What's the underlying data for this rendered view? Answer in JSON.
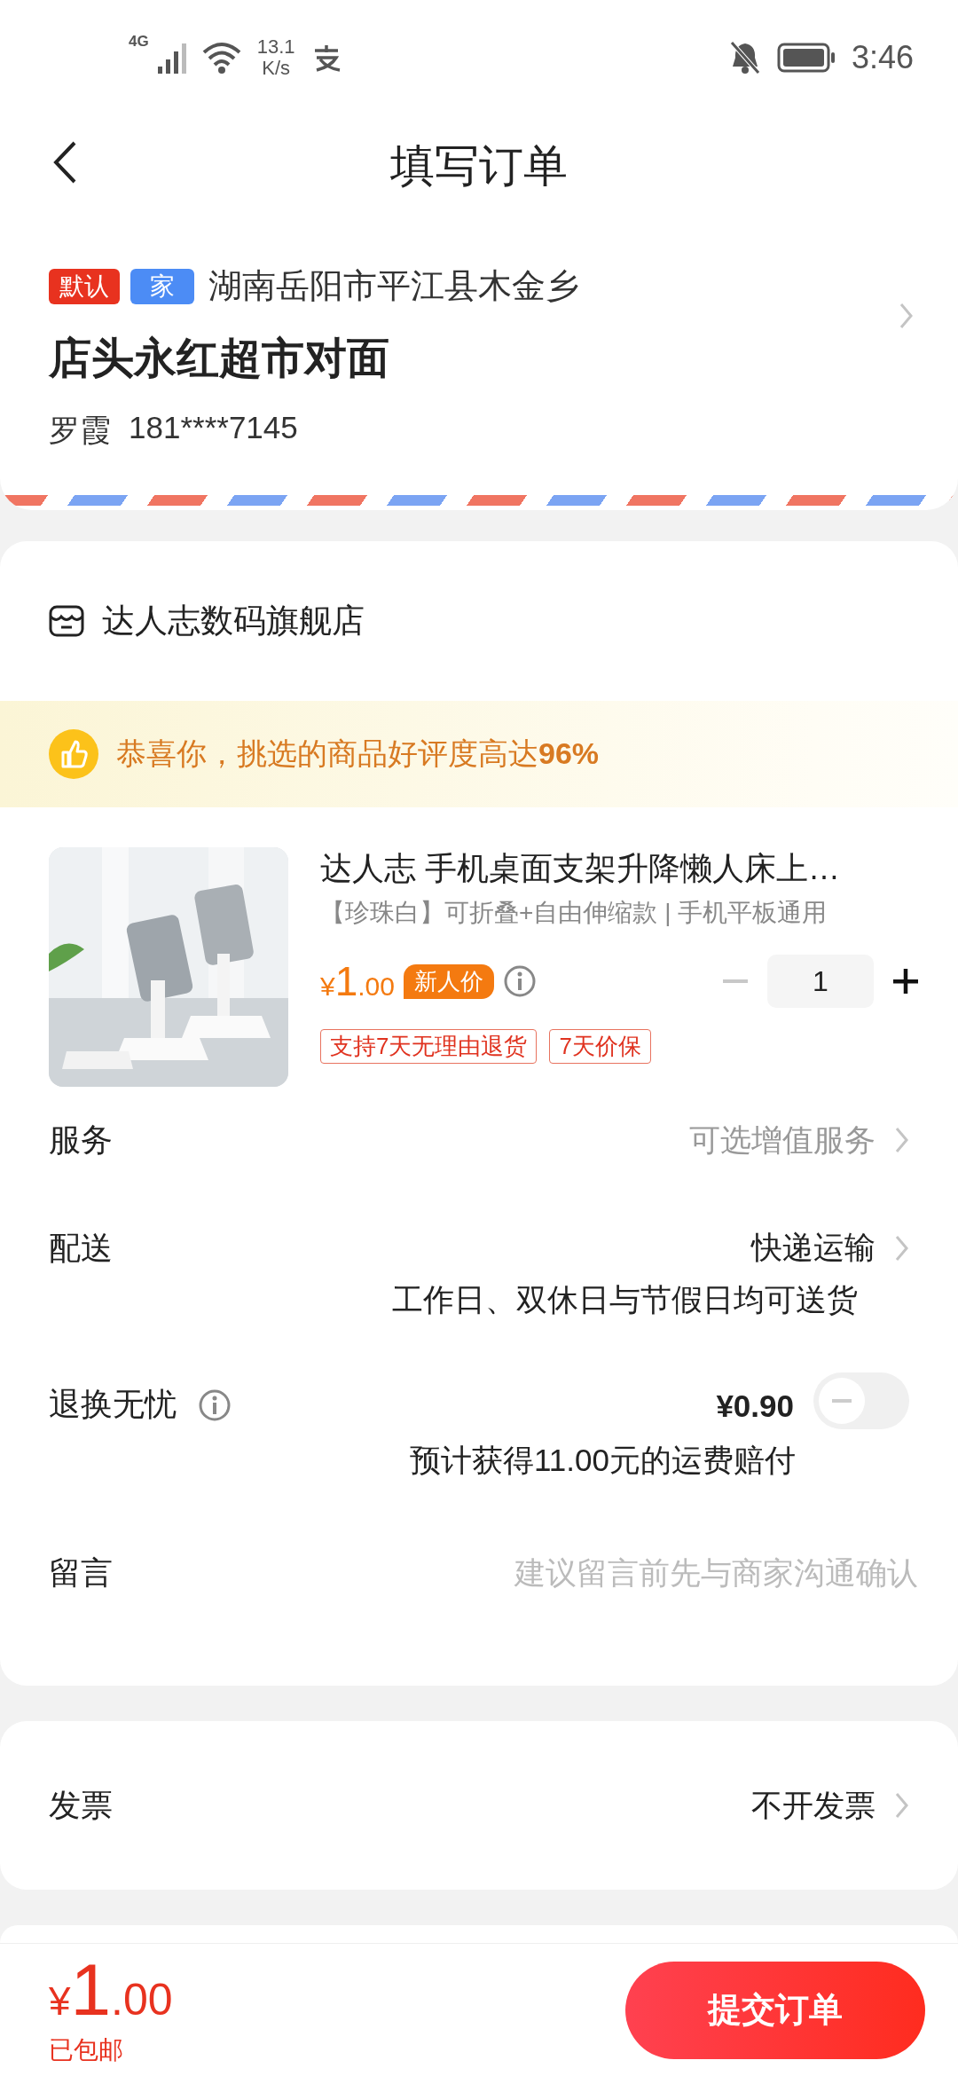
{
  "status_bar": {
    "network": "4G",
    "speed_value": "13.1",
    "speed_unit": "K/s",
    "time": "3:46"
  },
  "header": {
    "title": "填写订单"
  },
  "address": {
    "tags": [
      {
        "label": "默认",
        "color": "#e8321f"
      },
      {
        "label": "家",
        "color": "#4c8cf5"
      }
    ],
    "region": "湖南岳阳市平江县木金乡",
    "street": "店头永红超市对面",
    "recipient": "罗霞",
    "phone": "181****7145"
  },
  "store": {
    "name": "达人志数码旗舰店"
  },
  "banner": {
    "text": "恭喜你，挑选的商品好评度高达**96%**"
  },
  "product": {
    "title": "达人志 手机桌面支架升降懒人床上…",
    "spec": "【珍珠白】可折叠+自由伸缩款 | 手机平板通用",
    "price": {
      "currency": "¥",
      "integer": "1",
      "decimals": ".00"
    },
    "price_badge": "新人价",
    "quantity": "1",
    "tags": [
      "支持7天无理由退货",
      "7天价保"
    ]
  },
  "rows": [
    {
      "kind": "option",
      "label": "服务",
      "value": "可选增值服务"
    },
    {
      "kind": "delivery",
      "label": "配送",
      "value": "快递运输",
      "note": "工作日、双休日与节假日均可送货"
    },
    {
      "kind": "toggle",
      "label": "退换无忧",
      "price": "¥0.90",
      "note": "预计获得11.00元的运费赔付",
      "on": false
    },
    {
      "kind": "input",
      "label": "留言",
      "placeholder": "建议留言前先与商家沟通确认"
    }
  ],
  "invoice": {
    "label": "发票",
    "value": "不开发票"
  },
  "footer": {
    "price": {
      "currency": "¥",
      "integer": "1",
      "decimals": ".00"
    },
    "shipping": "已包邮",
    "submit": "提交订单"
  }
}
